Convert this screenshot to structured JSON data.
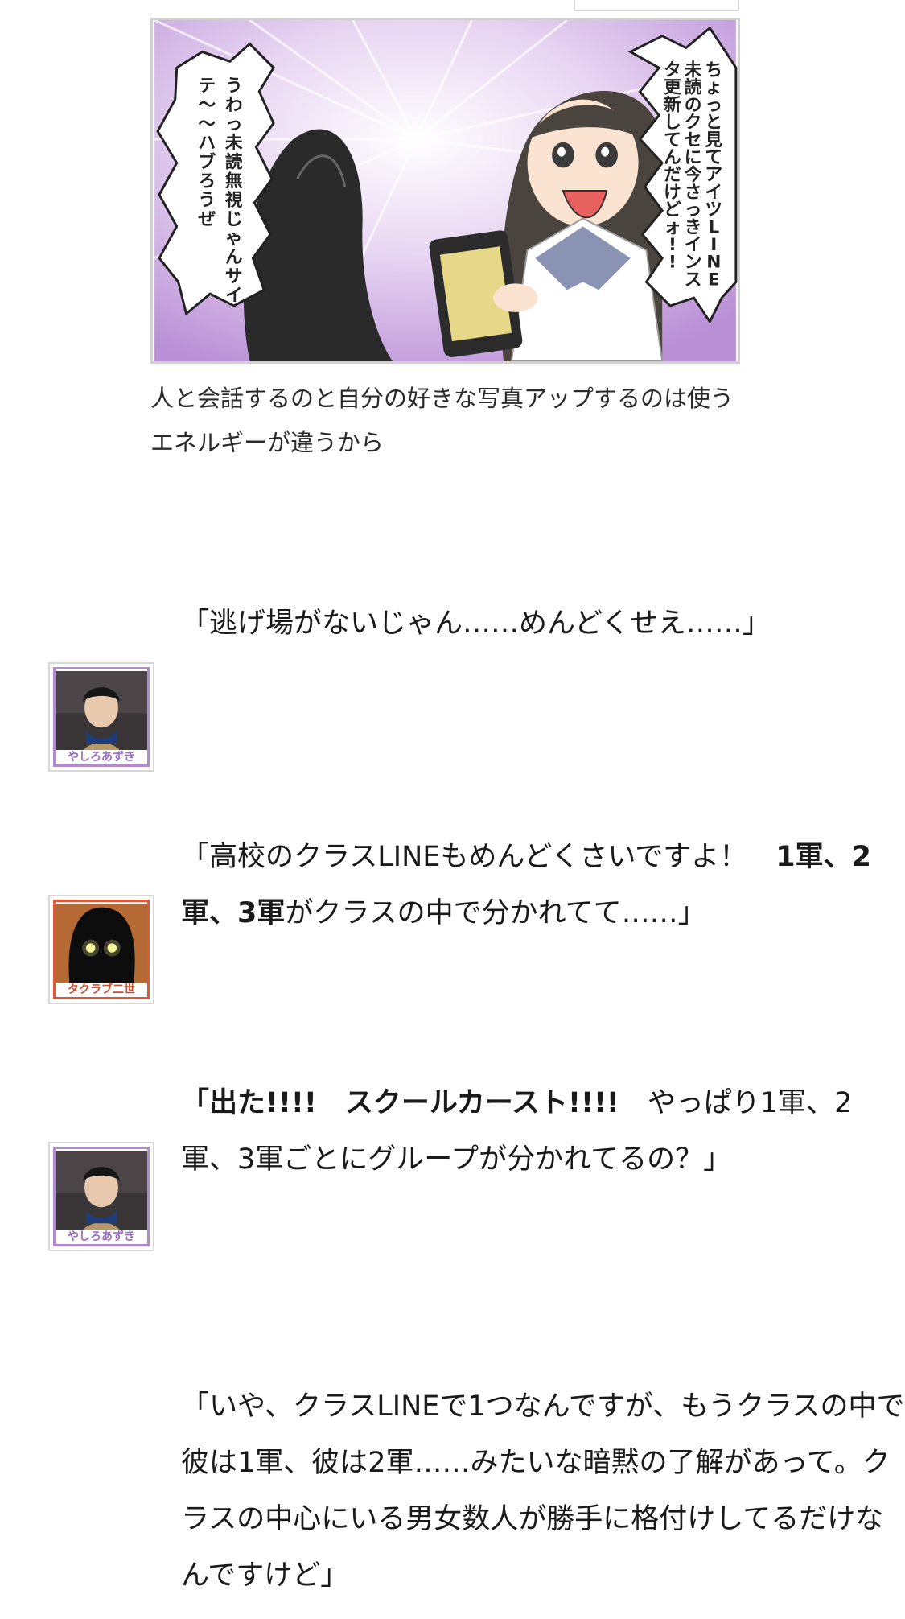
{
  "illustration": {
    "bubble_right": "ちょっと見てアイツLINE未読のクセに今さっきインスタ更新してんだけどォ!!",
    "bubble_left": "うわっ未読無視じゃんサイテ〜〜ハブろうぜ",
    "colors": {
      "background": "#c9a6e0",
      "burst": "#ffffff"
    }
  },
  "caption": "人と会話するのと自分の好きな写真アップするのは使うエネルギーが違うから",
  "messages": [
    {
      "speaker": "やしろあずき",
      "avatar_color": "#b18ad1",
      "segments": [
        {
          "text": "「逃げ場がないじゃん……めんどくせえ……」",
          "bold": false
        }
      ]
    },
    {
      "speaker": "タクラブ二世",
      "avatar_color": "#d85a3a",
      "segments": [
        {
          "text": "「高校のクラスLINEもめんどくさいですよ！　",
          "bold": false
        },
        {
          "text": "1軍、2軍、3軍",
          "bold": true
        },
        {
          "text": "がクラスの中で分かれてて……」",
          "bold": false
        }
      ]
    },
    {
      "speaker": "やしろあずき",
      "avatar_color": "#b18ad1",
      "segments": [
        {
          "text": "「出た!!!!　スクールカースト!!!!",
          "bold": true
        },
        {
          "text": "　やっぱり1軍、2軍、3軍ごとにグループが分かれてるの？」",
          "bold": false
        }
      ]
    },
    {
      "speaker": "",
      "segments": [
        {
          "text": "「いや、クラスLINEで1つなんですが、もうクラスの中で彼は1軍、彼は2軍……みたいな暗黙の了解があって。クラスの中心にいる男女数人が勝手に格付けしてるだけなんですけど」",
          "bold": false
        }
      ]
    }
  ]
}
